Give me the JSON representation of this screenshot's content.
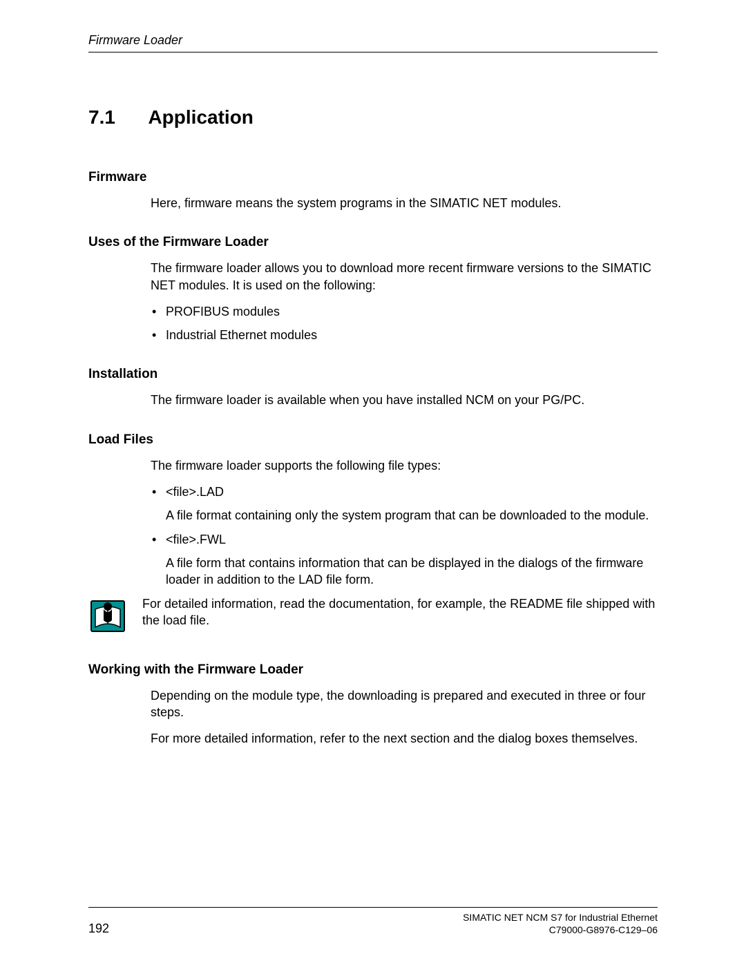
{
  "header": {
    "chapter": "Firmware Loader"
  },
  "section": {
    "number": "7.1",
    "title": "Application"
  },
  "firmware": {
    "heading": "Firmware",
    "text": "Here, firmware means the system programs in the SIMATIC NET modules."
  },
  "uses": {
    "heading": "Uses of the Firmware Loader",
    "intro": "The firmware loader allows you to download more recent firmware versions to the SIMATIC NET modules. It is used on the following:",
    "items": [
      "PROFIBUS modules",
      "Industrial Ethernet modules"
    ]
  },
  "installation": {
    "heading": "Installation",
    "text": "The firmware loader is available when you have installed NCM on your PG/PC."
  },
  "loadfiles": {
    "heading": "Load Files",
    "intro": "The firmware loader supports the following file types:",
    "items": [
      {
        "name": "<file>.LAD",
        "desc": "A file format containing only the system program that can be downloaded to the module."
      },
      {
        "name": "<file>.FWL",
        "desc": "A file form that contains information that can be displayed in the dialogs of the firmware loader in addition to the LAD file form."
      }
    ],
    "readme": "For detailed information, read the documentation, for example, the README file shipped with the load file."
  },
  "working": {
    "heading": "Working with the Firmware Loader",
    "p1": "Depending on the module type, the downloading is prepared and executed in three or four steps.",
    "p2": "For more detailed information, refer to the next section and the dialog boxes themselves."
  },
  "footer": {
    "page": "192",
    "line1": "SIMATIC NET NCM S7 for Industrial Ethernet",
    "line2": "C79000-G8976-C129–06"
  }
}
